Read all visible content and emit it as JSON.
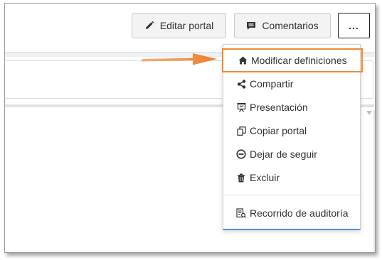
{
  "toolbar": {
    "edit_label": "Editar portal",
    "comments_label": "Comentarios",
    "more_label": "...",
    "edit_icon": "pencil-icon",
    "comments_icon": "comment-icon"
  },
  "menu": {
    "items": [
      {
        "label": "Modificar definiciones",
        "icon": "home-icon",
        "highlighted": true
      },
      {
        "label": "Compartir",
        "icon": "share-icon"
      },
      {
        "label": "Presentación",
        "icon": "presentation-icon"
      },
      {
        "label": "Copiar portal",
        "icon": "copy-icon"
      },
      {
        "label": "Dejar de seguir",
        "icon": "unfollow-icon"
      },
      {
        "label": "Excluir",
        "icon": "trash-icon"
      },
      {
        "label": "Recorrido de auditoría",
        "icon": "audit-trail-icon"
      }
    ]
  },
  "annotation": {
    "highlight_color": "#f08a34",
    "arrow_color": "#f08a34"
  }
}
